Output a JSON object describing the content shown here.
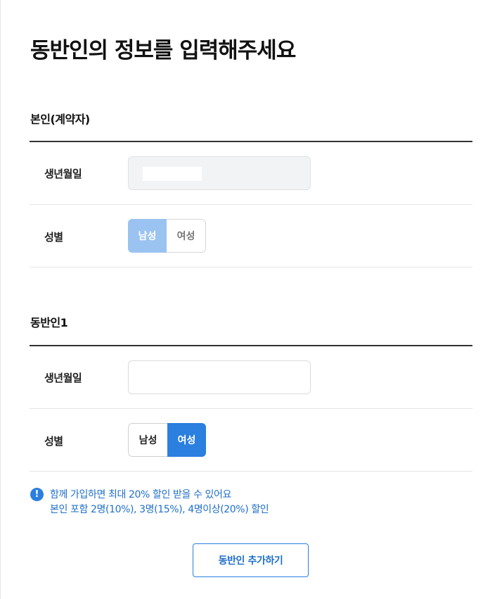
{
  "page": {
    "title": "동반인의 정보를 입력해주세요"
  },
  "self": {
    "section_title": "본인(계약자)",
    "birth_label": "생년월일",
    "birth_value": "",
    "gender_label": "성별",
    "gender_options": [
      "남성",
      "여성"
    ],
    "gender_selected": "남성",
    "disabled": true
  },
  "companion1": {
    "section_title": "동반인1",
    "birth_label": "생년월일",
    "birth_value": "",
    "gender_label": "성별",
    "gender_options": [
      "남성",
      "여성"
    ],
    "gender_selected": "여성"
  },
  "notice": {
    "icon": "info-icon",
    "icon_glyph": "!",
    "line1": "함께 가입하면 최대 20% 할인 받을 수 있어요",
    "line2": "본인 포함 2명(10%), 3명(15%), 4명이상(20%) 할인"
  },
  "add_button_label": "동반인 추가하기",
  "colors": {
    "accent": "#2a7fdf",
    "accent_disabled": "#9bc3f1",
    "notice_text": "#1f6fc9",
    "field_disabled_bg": "#f2f3f5"
  }
}
